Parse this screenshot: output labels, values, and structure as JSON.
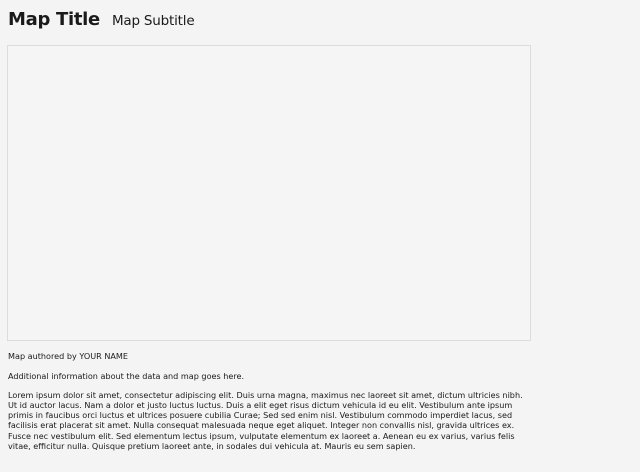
{
  "header": {
    "title": "Map Title",
    "subtitle": "Map Subtitle"
  },
  "footer": {
    "author": "Map authored by YOUR NAME",
    "info": "Additional information about the data and map goes here.",
    "description": "Lorem ipsum dolor sit amet, consectetur adipiscing elit. Duis urna magna, maximus nec laoreet sit amet, dictum ultricies nibh. Ut id auctor lacus. Nam a dolor et justo luctus luctus. Duis a elit eget risus dictum vehicula id eu elit. Vestibulum ante ipsum primis in faucibus orci luctus et ultrices posuere cubilia Curae; Sed sed enim nisl. Vestibulum commodo imperdiet lacus, sed facilisis erat placerat sit amet. Nulla consequat malesuada neque eget aliquet. Integer non convallis nisl, gravida ultrices ex. Fusce nec vestibulum elit. Sed elementum lectus ipsum, vulputate elementum ex laoreet a. Aenean eu ex varius, varius felis vitae, efficitur nulla. Quisque pretium laoreet ante, in sodales dui vehicula at. Mauris eu sem sapien."
  }
}
